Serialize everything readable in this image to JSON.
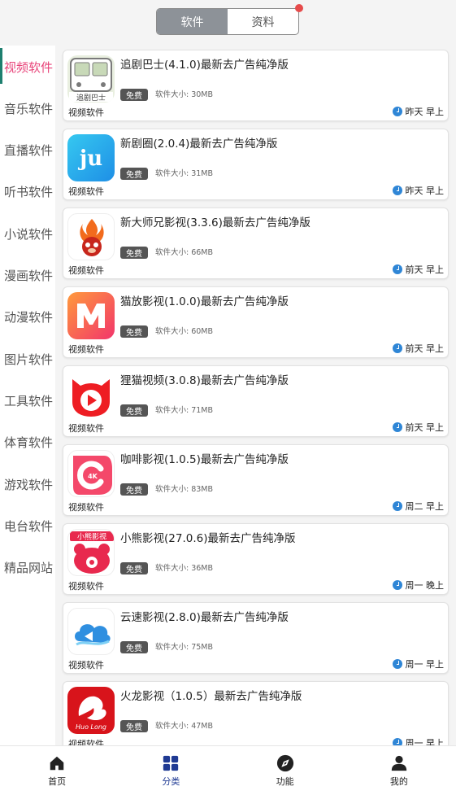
{
  "tabs": [
    {
      "label": "软件"
    },
    {
      "label": "资料"
    }
  ],
  "sidebar": {
    "items": [
      {
        "label": "视频软件"
      },
      {
        "label": "音乐软件"
      },
      {
        "label": "直播软件"
      },
      {
        "label": "听书软件"
      },
      {
        "label": "小说软件"
      },
      {
        "label": "漫画软件"
      },
      {
        "label": "动漫软件"
      },
      {
        "label": "图片软件"
      },
      {
        "label": "工具软件"
      },
      {
        "label": "体育软件"
      },
      {
        "label": "游戏软件"
      },
      {
        "label": "电台软件"
      },
      {
        "label": "精品网站"
      }
    ]
  },
  "apps": [
    {
      "title": "追剧巴士(4.1.0)最新去广告纯净版",
      "badge": "免费",
      "size": "软件大小: 30MB",
      "category": "视频软件",
      "time": "昨天 早上",
      "icon": "bus-icon",
      "icon_text": "追剧巴士"
    },
    {
      "title": "新剧圈(2.0.4)最新去广告纯净版",
      "badge": "免费",
      "size": "软件大小: 31MB",
      "category": "视频软件",
      "time": "昨天 早上",
      "icon": "ju-icon",
      "icon_text": "ju"
    },
    {
      "title": "新大师兄影视(3.3.6)最新去广告纯净版",
      "badge": "免费",
      "size": "软件大小: 66MB",
      "category": "视频软件",
      "time": "前天 早上",
      "icon": "monkey-icon"
    },
    {
      "title": "猫放影视(1.0.0)最新去广告纯净版",
      "badge": "免费",
      "size": "软件大小: 60MB",
      "category": "视频软件",
      "time": "前天 早上",
      "icon": "m-icon"
    },
    {
      "title": "狸猫视频(3.0.8)最新去广告纯净版",
      "badge": "免费",
      "size": "软件大小: 71MB",
      "category": "视频软件",
      "time": "前天 早上",
      "icon": "cat-play-icon"
    },
    {
      "title": "咖啡影视(1.0.5)最新去广告纯净版",
      "badge": "免费",
      "size": "软件大小: 83MB",
      "category": "视频软件",
      "time": "周二 早上",
      "icon": "4k-icon",
      "icon_text": "4K"
    },
    {
      "title": "小熊影视(27.0.6)最新去广告纯净版",
      "badge": "免费",
      "size": "软件大小: 36MB",
      "category": "视频软件",
      "time": "周一 晚上",
      "icon": "bear-icon",
      "icon_text": "小熊影视"
    },
    {
      "title": "云速影视(2.8.0)最新去广告纯净版",
      "badge": "免费",
      "size": "软件大小: 75MB",
      "category": "视频软件",
      "time": "周一 早上",
      "icon": "cloud-icon"
    },
    {
      "title": "火龙影视（1.0.5）最新去广告纯净版",
      "badge": "免费",
      "size": "软件大小: 47MB",
      "category": "视频软件",
      "time": "周一 早上",
      "icon": "dragon-icon",
      "icon_text": "Huo Long"
    }
  ],
  "bottom_nav": [
    {
      "label": "首页",
      "icon": "home-icon"
    },
    {
      "label": "分类",
      "icon": "grid-icon"
    },
    {
      "label": "功能",
      "icon": "compass-icon"
    },
    {
      "label": "我的",
      "icon": "user-icon"
    }
  ],
  "colors": {
    "accent": "#e8447a",
    "nav_active": "#1f3a93",
    "badge": "#555555",
    "clock": "#2f86d6"
  }
}
